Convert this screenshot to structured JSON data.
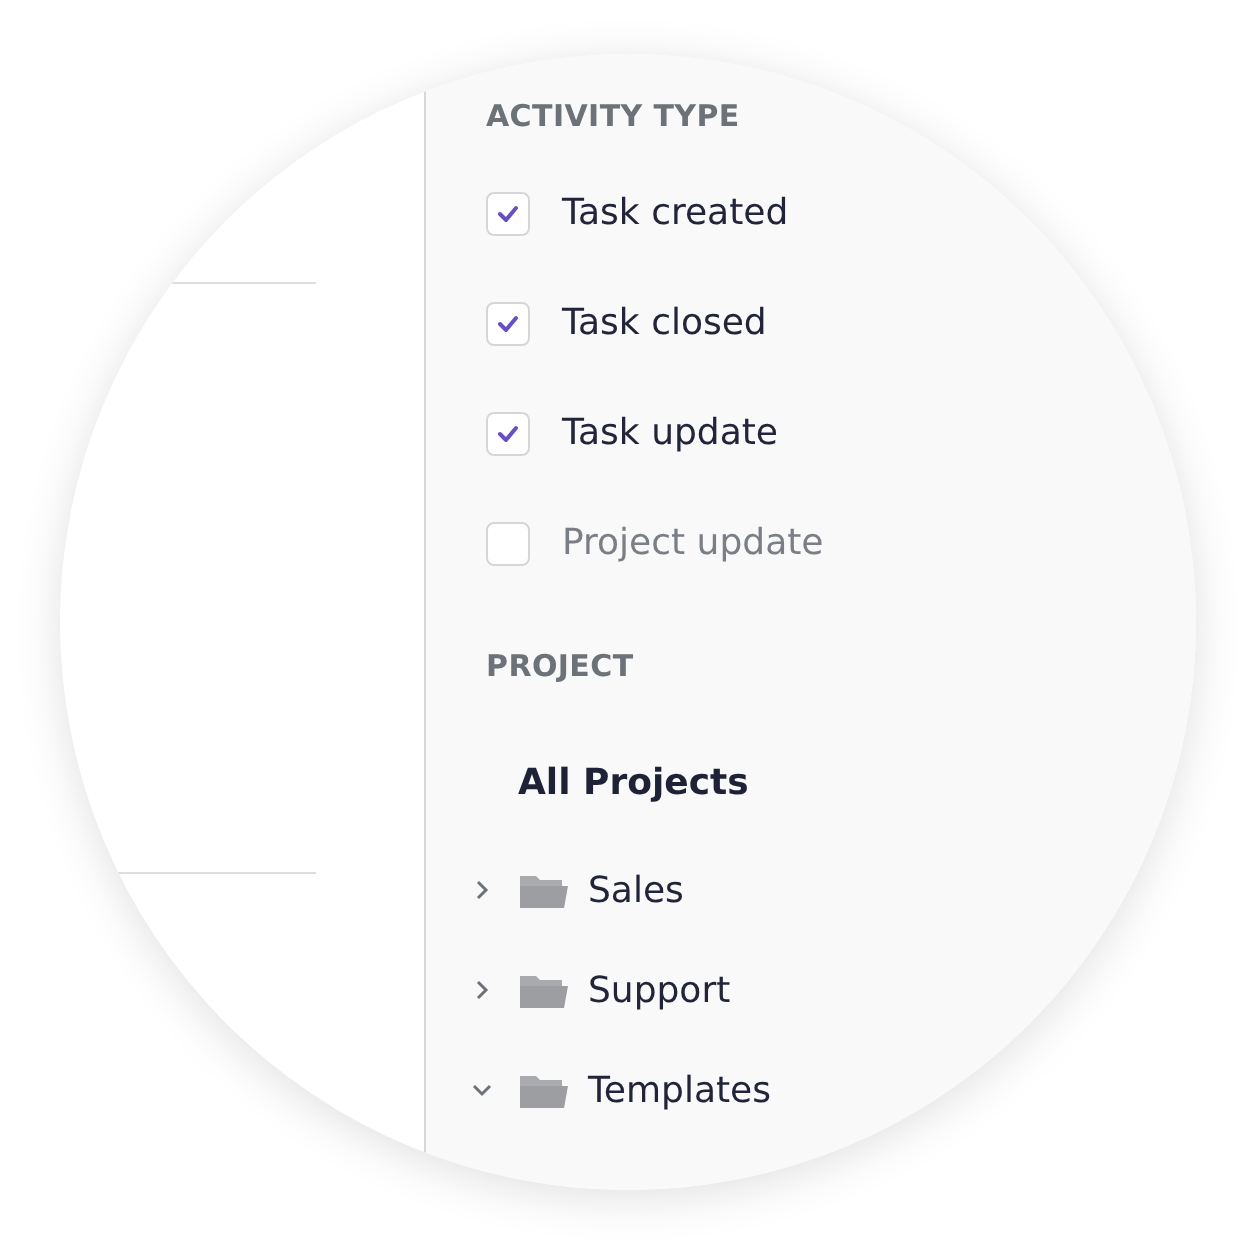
{
  "activity_type": {
    "heading": "ACTIVITY TYPE",
    "options": [
      {
        "label": "Task created",
        "checked": true
      },
      {
        "label": "Task closed",
        "checked": true
      },
      {
        "label": "Task update",
        "checked": true
      },
      {
        "label": "Project update",
        "checked": false
      }
    ]
  },
  "project": {
    "heading": "PROJECT",
    "all_label": "All Projects",
    "folders": [
      {
        "label": "Sales",
        "expanded": false
      },
      {
        "label": "Support",
        "expanded": false
      },
      {
        "label": "Templates",
        "expanded": true
      }
    ]
  }
}
